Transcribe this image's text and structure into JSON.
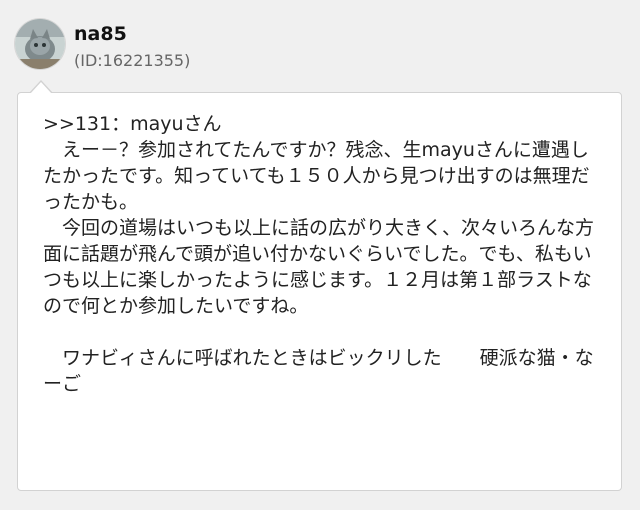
{
  "user": {
    "name": "na85",
    "id": "(ID:16221355)",
    "avatar_icon": "cat-photo-avatar"
  },
  "comment": {
    "reply_ref": ">>131",
    "reply_to": "：mayuさん",
    "body": "\n　えー－？参加されてたんですか？残念、生mayuさんに遭遇したかったです。知っていても１５０人から見つけ出すのは無理だったかも。\n　今回の道場はいつも以上に話の広がり大きく、次々いろんな方面に話題が飛んで頭が追い付かないぐらいでした。でも、私もいつも以上に楽しかったように感じます。１２月は第１部ラストなので何とか参加したいですね。\n\n　ワナビィさんに呼ばれたときはビックリした　　硬派な猫・なーご"
  }
}
